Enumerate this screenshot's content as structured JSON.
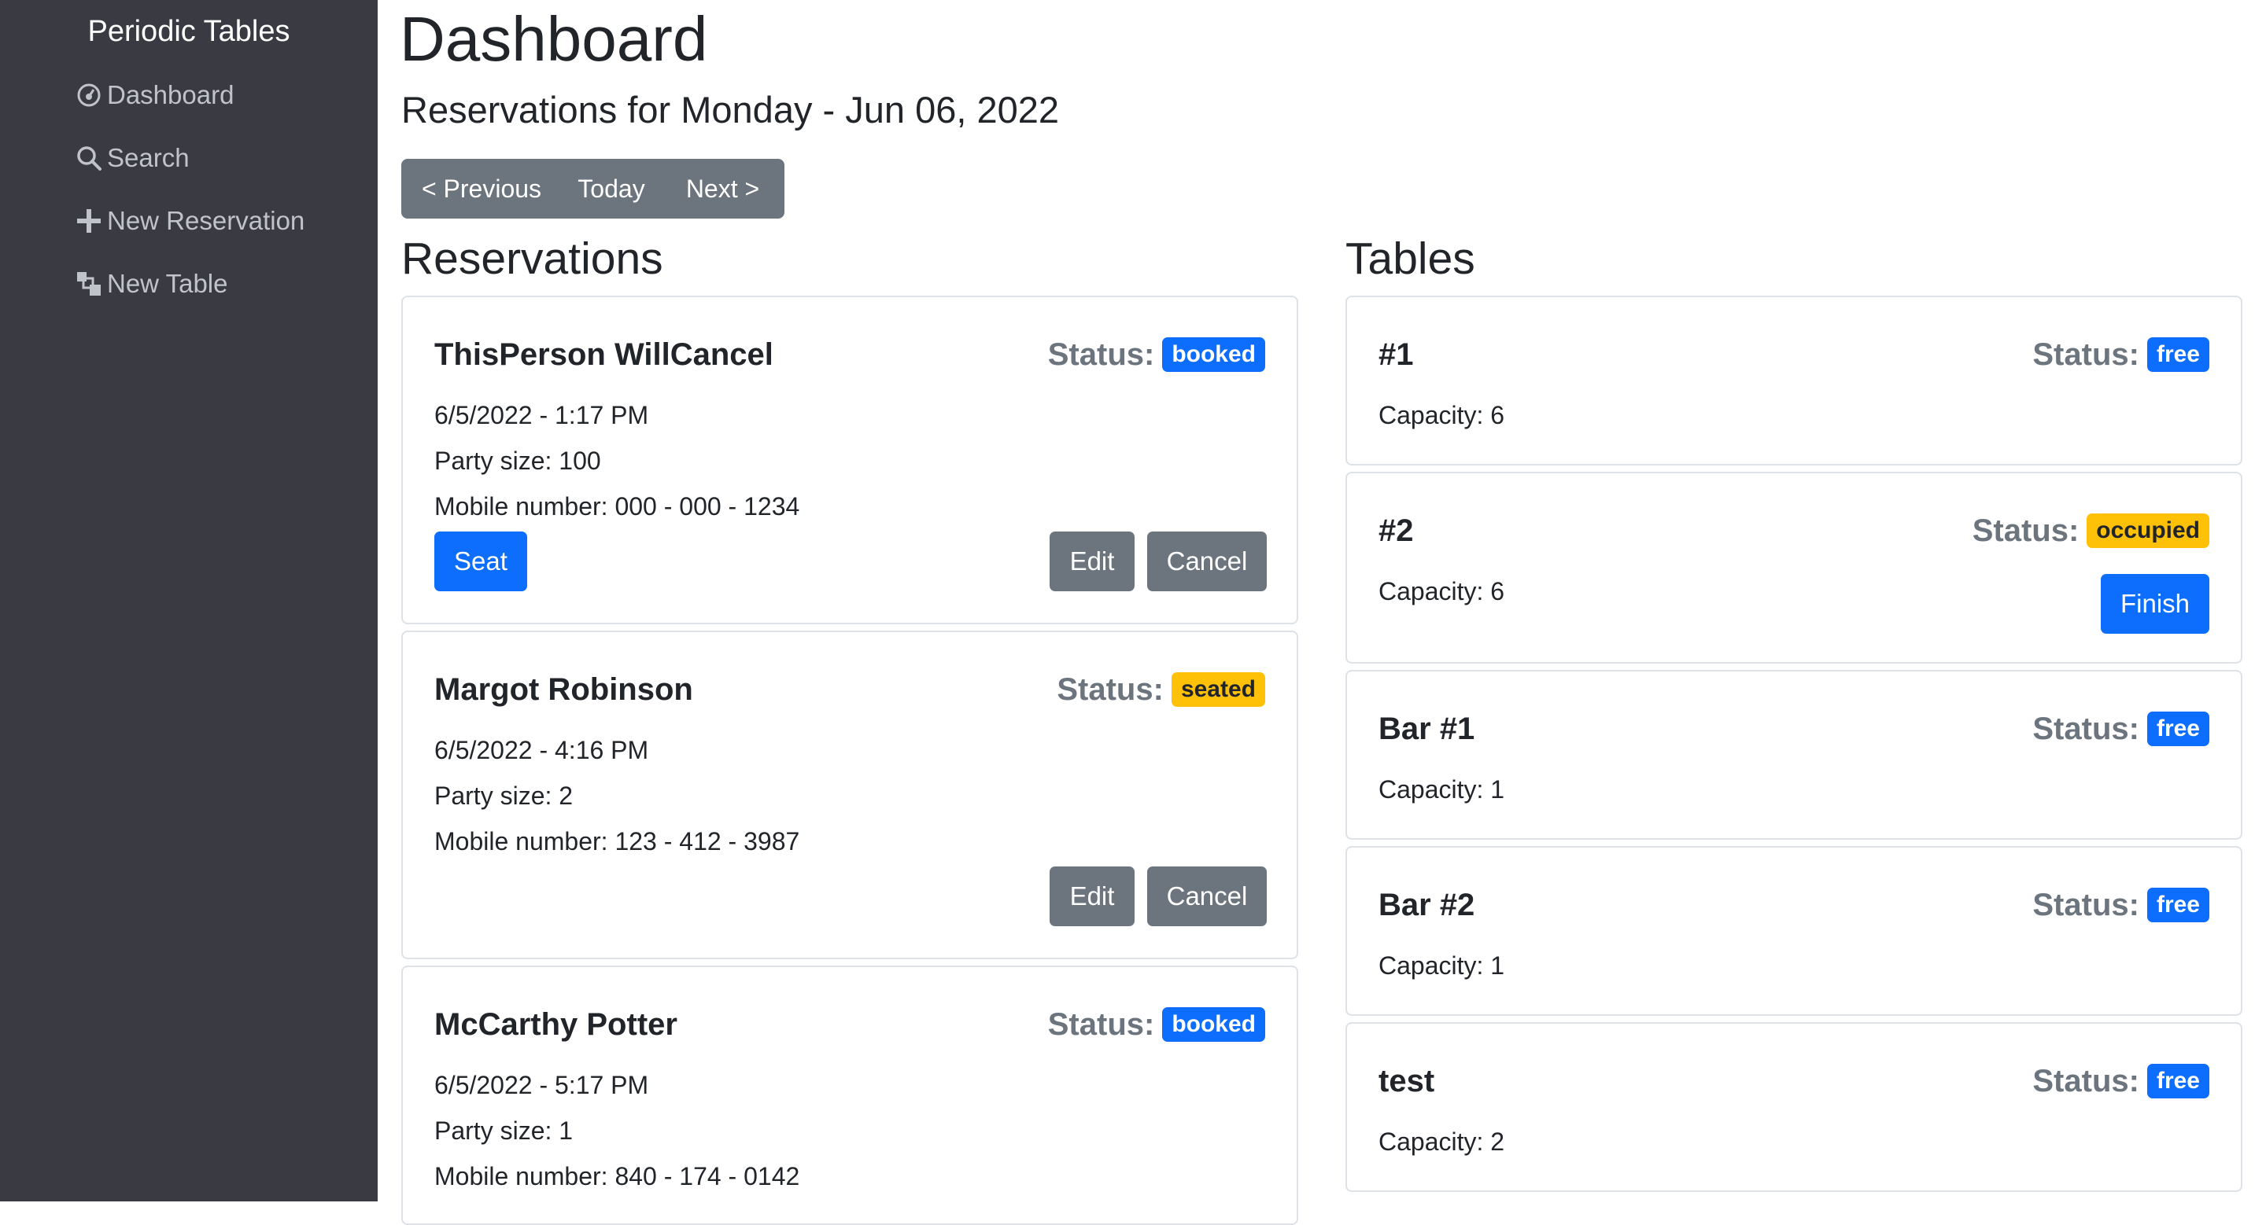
{
  "sidebar": {
    "brand": "Periodic Tables",
    "items": [
      {
        "label": "Dashboard",
        "icon": "dashboard-icon"
      },
      {
        "label": "Search",
        "icon": "search-icon"
      },
      {
        "label": "New Reservation",
        "icon": "plus-icon"
      },
      {
        "label": "New Table",
        "icon": "new-table-icon"
      }
    ]
  },
  "header": {
    "title": "Dashboard",
    "subtitle": "Reservations for Monday - Jun 06, 2022"
  },
  "date_nav": {
    "previous": "< Previous",
    "today": "Today",
    "next": "Next >"
  },
  "reservations": {
    "title": "Reservations",
    "status_label": "Status:",
    "seat_label": "Seat",
    "edit_label": "Edit",
    "cancel_label": "Cancel",
    "items": [
      {
        "name": "ThisPerson WillCancel",
        "status": "booked",
        "datetime": "6/5/2022 - 1:17 PM",
        "party": "Party size: 100",
        "mobile": "Mobile number: 000 - 000 - 1234"
      },
      {
        "name": "Margot Robinson",
        "status": "seated",
        "datetime": "6/5/2022 - 4:16 PM",
        "party": "Party size: 2",
        "mobile": "Mobile number: 123 - 412 - 3987"
      },
      {
        "name": "McCarthy Potter",
        "status": "booked",
        "datetime": "6/5/2022 - 5:17 PM",
        "party": "Party size: 1",
        "mobile": "Mobile number: 840 - 174 - 0142"
      }
    ]
  },
  "tables": {
    "title": "Tables",
    "status_label": "Status:",
    "finish_label": "Finish",
    "items": [
      {
        "name": "#1",
        "status": "free",
        "capacity": "Capacity: 6"
      },
      {
        "name": "#2",
        "status": "occupied",
        "capacity": "Capacity: 6"
      },
      {
        "name": "Bar #1",
        "status": "free",
        "capacity": "Capacity: 1"
      },
      {
        "name": "Bar #2",
        "status": "free",
        "capacity": "Capacity: 1"
      },
      {
        "name": "test",
        "status": "free",
        "capacity": "Capacity: 2"
      }
    ]
  },
  "colors": {
    "sidebar_bg": "#3a3b42",
    "primary": "#0d6efd",
    "secondary": "#6c757d",
    "warning": "#ffc107"
  }
}
